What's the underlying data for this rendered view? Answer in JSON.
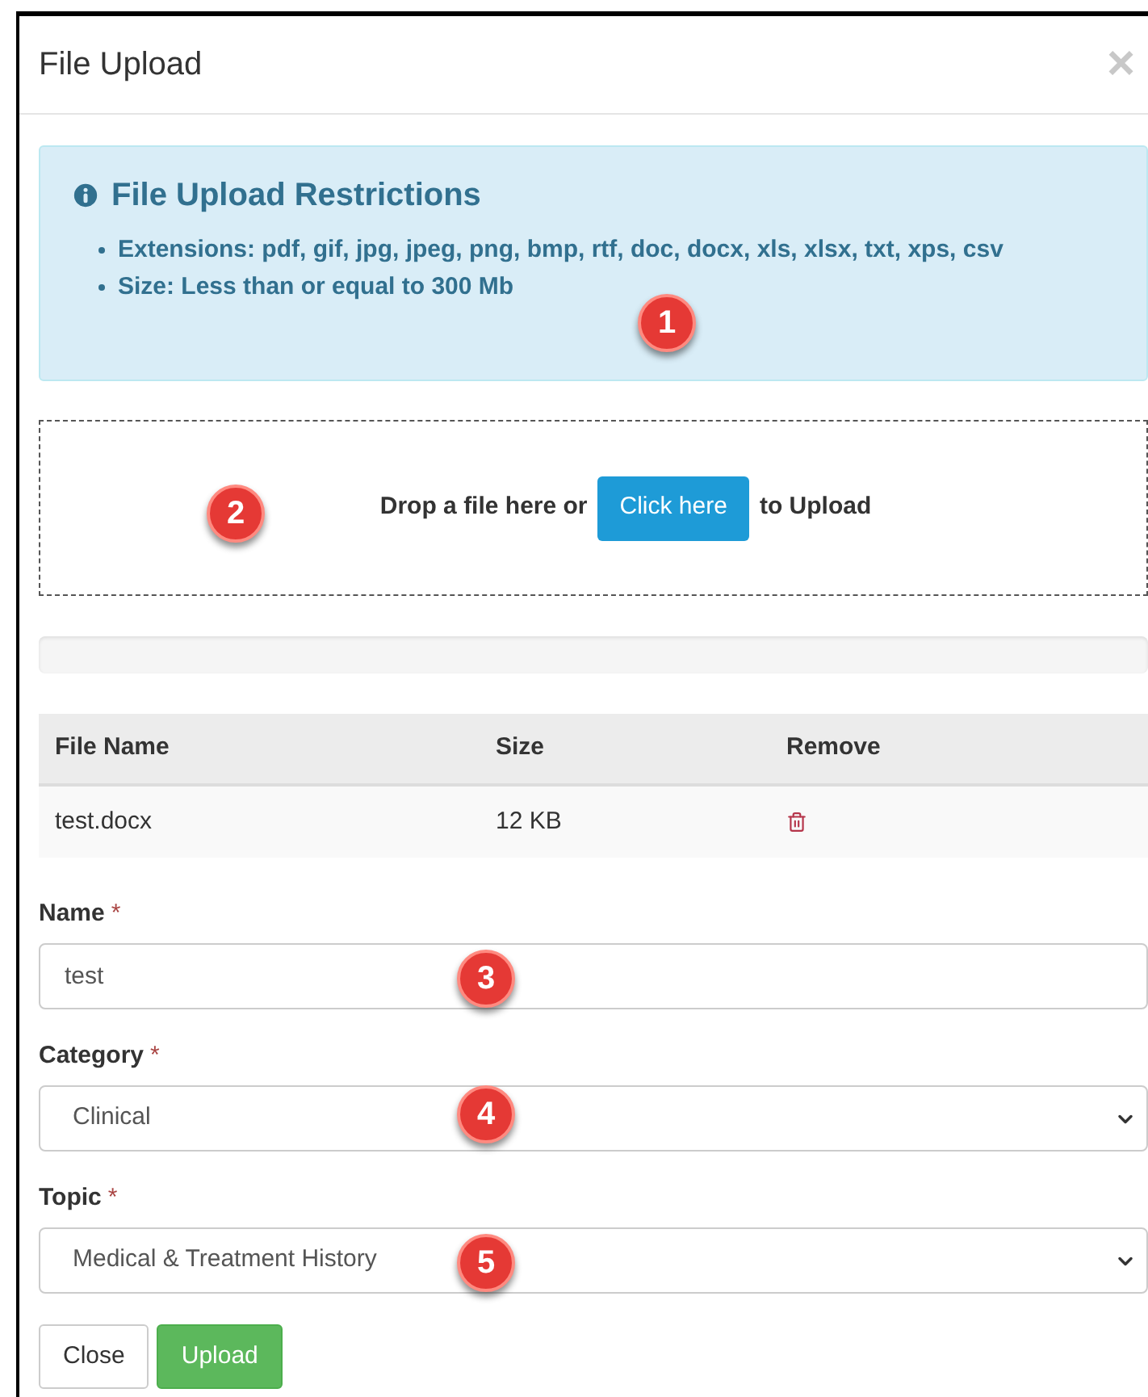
{
  "dialog": {
    "title": "File Upload",
    "close_glyph": "×"
  },
  "restrictions": {
    "title": "File Upload Restrictions",
    "items": [
      "Extensions: pdf, gif, jpg, jpeg, png, bmp, rtf, doc, docx, xls, xlsx, txt, xps, csv",
      "Size: Less than or equal to 300 Mb"
    ]
  },
  "dropzone": {
    "before": "Drop a file here or",
    "button": "Click here",
    "after": "to Upload"
  },
  "progress": {
    "level": 0
  },
  "table": {
    "columns": [
      "File Name",
      "Size",
      "Remove"
    ],
    "rows": [
      {
        "file_name": "test.docx",
        "size": "12 KB"
      }
    ]
  },
  "fields": [
    {
      "kind": "text",
      "label": "Name",
      "required_mark": "*",
      "value": "test"
    },
    {
      "kind": "select",
      "label": "Category",
      "required_mark": "*",
      "value": "Clinical"
    },
    {
      "kind": "select",
      "label": "Topic",
      "required_mark": "*",
      "value": "Medical & Treatment History"
    }
  ],
  "buttons": [
    {
      "label": "Close",
      "kind": "default"
    },
    {
      "label": "Upload",
      "kind": "success"
    }
  ],
  "callouts": [
    "1",
    "2",
    "3",
    "4",
    "5"
  ]
}
